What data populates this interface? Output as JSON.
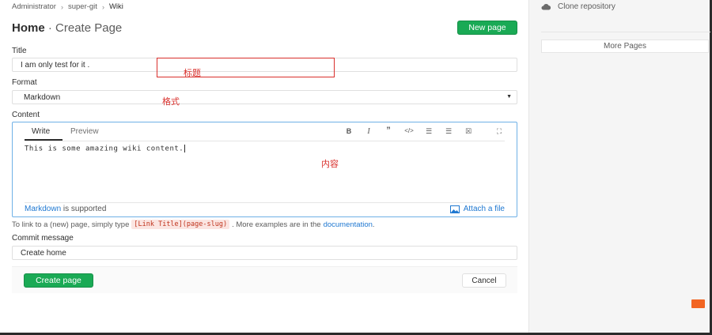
{
  "breadcrumb": [
    "Administrator",
    "super-git",
    "Wiki"
  ],
  "title": {
    "home": "Home",
    "separator": " · ",
    "sub": "Create Page"
  },
  "new_page_label": "New page",
  "form": {
    "title_label": "Title",
    "title_value": "I am only test for it .",
    "format_label": "Format",
    "format_value": "Markdown",
    "content_label": "Content",
    "commit_label": "Commit message",
    "commit_value": "Create home"
  },
  "annotations": {
    "title": "标题",
    "format": "格式",
    "content": "内容"
  },
  "editor": {
    "tab_write": "Write",
    "tab_preview": "Preview",
    "content": "This is some amazing wiki content.",
    "toolbar": [
      "bold-icon",
      "italic-icon",
      "quote-icon",
      "code-icon",
      "bullet-list-icon",
      "numbered-list-icon",
      "task-list-icon",
      "fullscreen-icon"
    ],
    "markdown_link": "Markdown",
    "markdown_suffix": " is supported",
    "attach_label": "Attach a file"
  },
  "help": {
    "prefix": "To link to a (new) page, simply type",
    "code": "[Link Title](page-slug)",
    "middle": ". More examples are in the",
    "link": "documentation",
    "suffix": "."
  },
  "actions": {
    "create_label": "Create page",
    "cancel_label": "Cancel"
  },
  "sidebar": {
    "clone_label": "Clone repository",
    "more_pages_label": "More Pages"
  },
  "colors": {
    "primary_green": "#1aaa55",
    "link_blue": "#1f78d1",
    "annotation_red": "#d9302c"
  }
}
